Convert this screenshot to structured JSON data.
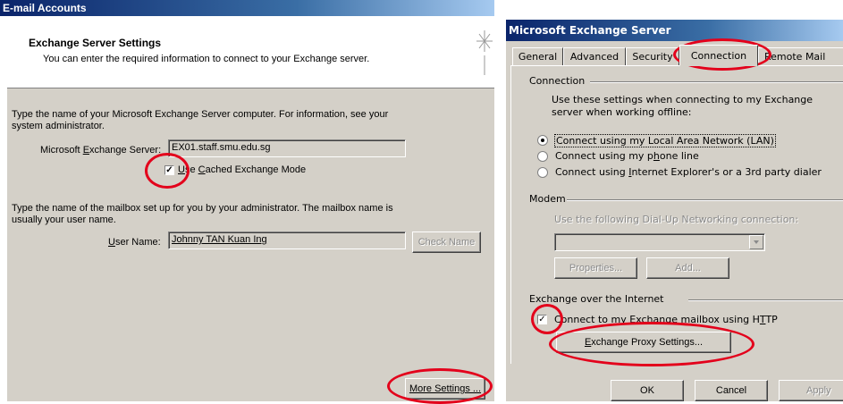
{
  "left": {
    "title": "E-mail Accounts",
    "header": {
      "title": "Exchange Server Settings",
      "subtitle": "You can enter the required information to connect to your Exchange server."
    },
    "server_instructions": "Type the name of your Microsoft Exchange Server computer. For information, see your system administrator.",
    "server_label": "Microsoft Exchange Server:",
    "server_value": "EX01.staff.smu.edu.sg",
    "cached_mode_label": "Use Cached Exchange Mode",
    "cached_mode_checked": true,
    "mailbox_instructions": "Type the name of the mailbox set up for you by your administrator. The mailbox name is usually your user name.",
    "user_label": "User Name:",
    "user_value": "Johnny TAN Kuan Ing",
    "check_name_button": "Check Name",
    "more_settings_button": "More Settings ..."
  },
  "right": {
    "title": "Microsoft Exchange Server",
    "tabs": [
      "General",
      "Advanced",
      "Security",
      "Connection",
      "Remote Mail"
    ],
    "active_tab": "Connection",
    "connection_group": "Connection",
    "connection_desc": "Use these settings when connecting to my Exchange server when working offline:",
    "options": [
      {
        "label": "Connect using my Local Area Network (LAN)",
        "selected": true
      },
      {
        "label": "Connect using my phone line",
        "selected": false
      },
      {
        "label": "Connect using Internet Explorer's or a 3rd party dialer",
        "selected": false
      }
    ],
    "modem_group": "Modem",
    "modem_desc": "Use the following Dial-Up Networking connection:",
    "properties_button": "Properties...",
    "add_button": "Add...",
    "internet_group": "Exchange over the Internet",
    "http_label": "Connect to my Exchange mailbox using HTTP",
    "http_checked": true,
    "proxy_button": "Exchange Proxy Settings...",
    "ok_button": "OK",
    "cancel_button": "Cancel",
    "apply_button": "Apply"
  },
  "colors": {
    "annotation": "#e3001b",
    "dialog_face": "#d4d0c8",
    "title_bar": "#0a246a"
  }
}
